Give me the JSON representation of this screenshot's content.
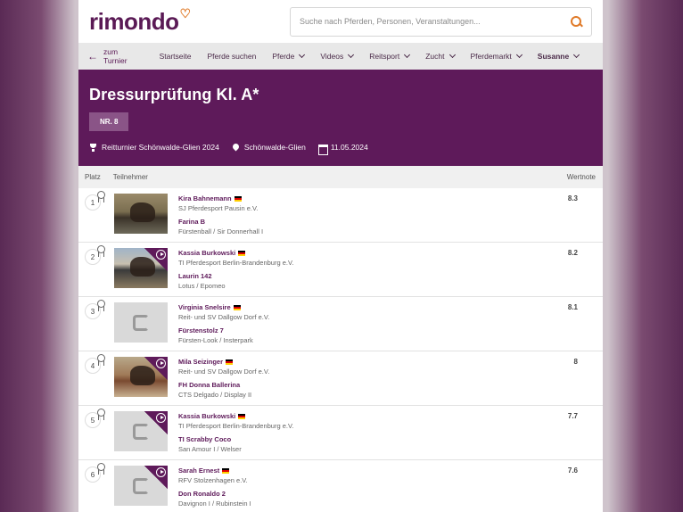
{
  "header": {
    "logo_text": "rimondo",
    "search_placeholder": "Suche nach Pferden, Personen, Veranstaltungen..."
  },
  "nav": {
    "back_label": "zum Turnier",
    "items": [
      {
        "label": "Startseite",
        "dropdown": false
      },
      {
        "label": "Pferde suchen",
        "dropdown": false
      },
      {
        "label": "Pferde",
        "dropdown": true
      },
      {
        "label": "Videos",
        "dropdown": true
      },
      {
        "label": "Reitsport",
        "dropdown": true
      },
      {
        "label": "Zucht",
        "dropdown": true
      },
      {
        "label": "Pferdemarkt",
        "dropdown": true
      },
      {
        "label": "Susanne",
        "dropdown": true
      }
    ]
  },
  "hero": {
    "title": "Dressurprüfung Kl. A*",
    "badge": "NR. 8",
    "tournament": "Reitturnier Schönwalde-Glien 2024",
    "location": "Schönwalde-Glien",
    "date": "11.05.2024"
  },
  "table": {
    "col_place": "Platz",
    "col_participant": "Teilnehmer",
    "col_score": "Wertnote",
    "rows": [
      {
        "place": "1",
        "rider": "Kira Bahnemann",
        "club": "SJ Pferdesport Pausin e.V.",
        "horse": "Farina B",
        "pedigree": "Fürstenball / Sir Donnerhall I",
        "score": "8.3",
        "thumb": "photo1",
        "video": false
      },
      {
        "place": "2",
        "rider": "Kassia Burkowski",
        "club": "TI Pferdesport Berlin-Brandenburg e.V.",
        "horse": "Laurin 142",
        "pedigree": "Lotus / Epomeo",
        "score": "8.2",
        "thumb": "photo2",
        "video": true
      },
      {
        "place": "3",
        "rider": "Virginia Snelsire",
        "club": "Reit- und SV Dallgow Dorf e.V.",
        "horse": "Fürstenstolz 7",
        "pedigree": "Fürsten-Look / Insterpark",
        "score": "8.1",
        "thumb": "placeholder",
        "video": false
      },
      {
        "place": "4",
        "rider": "Mila Seizinger",
        "club": "Reit- und SV Dallgow Dorf e.V.",
        "horse": "FH Donna Ballerina",
        "pedigree": "CTS Delgado / Display II",
        "score": "8",
        "thumb": "photo4",
        "video": true
      },
      {
        "place": "5",
        "rider": "Kassia Burkowski",
        "club": "TI Pferdesport Berlin-Brandenburg e.V.",
        "horse": "TI Scrabby Coco",
        "pedigree": "San Amour I / Welser",
        "score": "7.7",
        "thumb": "placeholder",
        "video": true
      },
      {
        "place": "6",
        "rider": "Sarah Ernest",
        "club": "RFV Stolzenhagen e.V.",
        "horse": "Don Ronaldo 2",
        "pedigree": "Davignon I / Rubinstein I",
        "score": "7.6",
        "thumb": "placeholder",
        "video": true
      }
    ]
  },
  "colors": {
    "brand": "#5e1a5a",
    "accent": "#e07a28"
  }
}
